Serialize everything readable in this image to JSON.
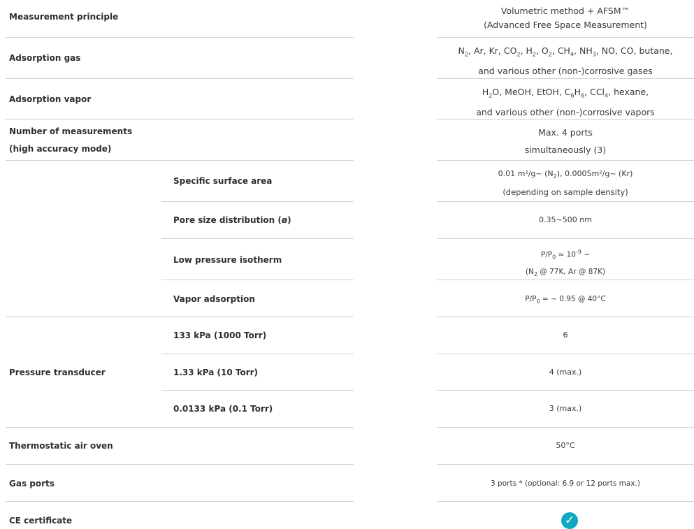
{
  "rows": {
    "measurement_principle": {
      "label": "Measurement principle",
      "value_line1": "Volumetric method + AFSM™",
      "value_line2": "(Advanced Free Space Measurement)"
    },
    "adsorption_gas": {
      "label": "Adsorption gas",
      "gas_n": "N",
      "gas_n_sub": "2",
      "gas_list_a": ", Ar, Kr, CO",
      "gas_co_sub": "2",
      "gas_list_b": ", H",
      "gas_h_sub": "2",
      "gas_list_c": ", O",
      "gas_o_sub": "2",
      "gas_list_d": ", CH",
      "gas_ch_sub": "4",
      "gas_list_e": ", NH",
      "gas_nh_sub": "3",
      "gas_list_f": ", NO, CO, butane,",
      "value_line2": "and various other (non-)corrosive gases"
    },
    "adsorption_vapor": {
      "label": "Adsorption vapor",
      "v_h": "H",
      "v_h_sub": "2",
      "v_a": "O, MeOH, EtOH, C",
      "v_c_sub": "6",
      "v_b": "H",
      "v_h6_sub": "6",
      "v_c": ", CCl",
      "v_cl_sub": "4",
      "v_d": ", hexane,",
      "value_line2": "and various other (non-)corrosive vapors"
    },
    "number_measurements": {
      "label_line1": "Number of measurements",
      "label_line2": "(high accuracy mode)",
      "value_line1": "Max. 4 ports",
      "value_line2": "simultaneously (3)"
    },
    "specific_surface": {
      "sublabel": "Specific surface area",
      "v_a": "0.01 m²/g~ (N",
      "v_sub": "2",
      "v_b": "), 0.0005m²/g~ (Kr)",
      "value_line2": "(depending on sample density)"
    },
    "pore_size": {
      "sublabel": "Pore size distribution (ø)",
      "value": "0.35~500 nm"
    },
    "low_pressure": {
      "sublabel": "Low pressure isotherm",
      "v_a": "P/P",
      "v_sub": "0",
      "v_b": " ≈ 10",
      "v_sup": "-9",
      "v_c": " ~",
      "l2_a": "(N",
      "l2_sub": "2",
      "l2_b": " @ 77K, Ar @ 87K)"
    },
    "vapor_adsorption": {
      "sublabel": "Vapor adsorption",
      "v_a": "P/P",
      "v_sub": "0",
      "v_b": " = ~ 0.95 @ 40°C"
    },
    "pressure_transducer": {
      "label": "Pressure transducer",
      "sub1": "133 kPa (1000 Torr)",
      "val1": "6",
      "sub2": "1.33 kPa (10 Torr)",
      "val2": "4 (max.)",
      "sub3": "0.0133 kPa (0.1 Torr)",
      "val3": "3 (max.)"
    },
    "thermostatic": {
      "label": "Thermostatic air oven",
      "value": "50°C"
    },
    "gas_ports": {
      "label": "Gas ports",
      "value": "3 ports * (optional: 6.9 or 12 ports max.)"
    },
    "ce": {
      "label": "CE certificate",
      "icon": "checkmark-icon",
      "icon_glyph": "✓"
    }
  },
  "colors": {
    "divider": "#cfcfcf",
    "check_icon": "#11a9c2"
  }
}
